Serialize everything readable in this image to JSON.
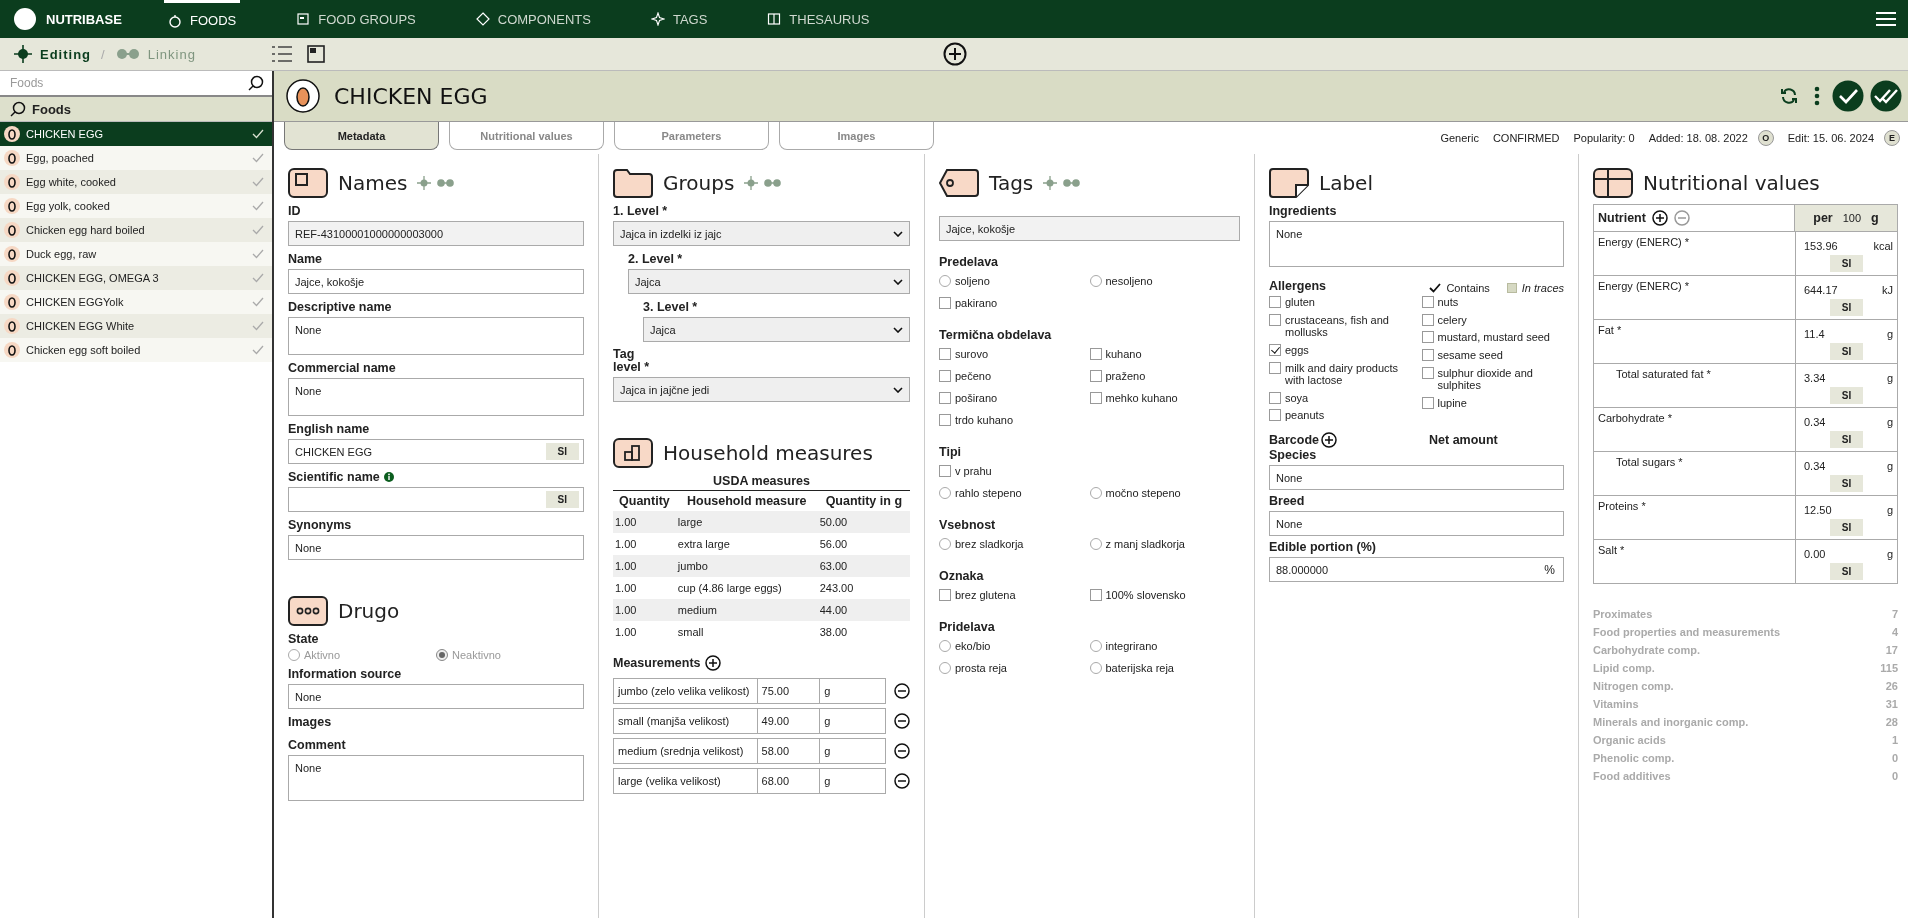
{
  "nav": {
    "brand": "NUTRIBASE",
    "items": [
      {
        "label": "FOODS",
        "kind": "timer",
        "selected": true
      },
      {
        "label": "FOOD GROUPS",
        "kind": "square",
        "selected": false
      },
      {
        "label": "COMPONENTS",
        "kind": "diamond",
        "selected": false
      },
      {
        "label": "TAGS",
        "kind": "sparkle",
        "selected": false
      },
      {
        "label": "THESAURUS",
        "kind": "book",
        "selected": false
      }
    ]
  },
  "modes": [
    {
      "label": "Editing",
      "kind": "edit",
      "selected": true
    },
    {
      "label": "Linking",
      "kind": "link",
      "selected": false
    }
  ],
  "mode_separator": "/",
  "sidebar": {
    "search_placeholder": "Foods",
    "header": "Foods",
    "items": [
      {
        "label": "CHICKEN EGG",
        "selected": true
      },
      {
        "label": "Egg, poached",
        "selected": false
      },
      {
        "label": "Egg white, cooked",
        "selected": false
      },
      {
        "label": "Egg yolk, cooked",
        "selected": false
      },
      {
        "label": "Chicken egg hard boiled",
        "selected": false
      },
      {
        "label": "Duck egg, raw",
        "selected": false
      },
      {
        "label": "CHICKEN EGG, OMEGA 3",
        "selected": false
      },
      {
        "label": "CHICKEN EGGYolk",
        "selected": false
      },
      {
        "label": "CHICKEN EGG White",
        "selected": false
      },
      {
        "label": "Chicken egg soft boiled",
        "selected": false
      }
    ]
  },
  "food": {
    "title": "CHICKEN EGG"
  },
  "tabs": [
    {
      "label": "Metadata",
      "selected": true
    },
    {
      "label": "Nutritional values",
      "selected": false
    },
    {
      "label": "Parameters",
      "selected": false
    },
    {
      "label": "Images",
      "selected": false
    }
  ],
  "status": [
    {
      "text": "Generic"
    },
    {
      "text": "CONFIRMED"
    },
    {
      "text": "Popularity: 0"
    },
    {
      "text": "Added: 18. 08. 2022",
      "badge": "O"
    },
    {
      "text": "Edit: 15. 06. 2024",
      "badge": "E"
    }
  ],
  "names": {
    "title": "Names",
    "fields": [
      {
        "label": "ID",
        "value": "REF-43100001000000003000",
        "kind": "readonly"
      },
      {
        "label": "Name",
        "value": "Jajce, kokošje",
        "kind": "text"
      },
      {
        "label": "Descriptive name",
        "value": "None",
        "kind": "textarea"
      },
      {
        "label": "Commercial name",
        "value": "None",
        "kind": "textarea"
      },
      {
        "label": "English name",
        "value": "CHICKEN EGG",
        "kind": "text",
        "si": "SI"
      },
      {
        "label": "Scientific name",
        "kind": "text",
        "si": "SI",
        "info": true
      },
      {
        "label": "Synonyms",
        "value": "None",
        "kind": "text"
      }
    ]
  },
  "drugo": {
    "title": "Drugo",
    "state": {
      "label": "State",
      "disabled": true,
      "options": [
        {
          "label": "Aktivno",
          "selected": false
        },
        {
          "label": "Neaktivno",
          "selected": true
        }
      ]
    },
    "fields": [
      {
        "label": "Information source",
        "value": "None",
        "kind": "text"
      },
      {
        "label": "Images",
        "kind": "label"
      },
      {
        "label": "Comment",
        "value": "None",
        "kind": "textarea"
      }
    ]
  },
  "groups": {
    "title": "Groups",
    "levels": [
      {
        "label": "1. Level *",
        "value": "Jajca in izdelki iz jajc"
      },
      {
        "label": "2. Level *",
        "value": "Jajca"
      },
      {
        "label": "3. Level *",
        "value": "Jajca"
      }
    ],
    "tag_level": {
      "label": "Tag level *",
      "value": "Jajca in jajčne jedi"
    }
  },
  "household": {
    "title": "Household measures",
    "usda": {
      "title": "USDA measures",
      "columns": [
        "Quantity",
        "Household measure",
        "Quantity in g"
      ],
      "rows": [
        [
          "1.00",
          "large",
          "50.00"
        ],
        [
          "1.00",
          "extra large",
          "56.00"
        ],
        [
          "1.00",
          "jumbo",
          "63.00"
        ],
        [
          "1.00",
          "cup (4.86 large eggs)",
          "243.00"
        ],
        [
          "1.00",
          "medium",
          "44.00"
        ],
        [
          "1.00",
          "small",
          "38.00"
        ]
      ]
    },
    "measurements": {
      "label": "Measurements",
      "rows": [
        {
          "name": "jumbo (zelo velika velikost)",
          "amount": "75.00",
          "unit": "g"
        },
        {
          "name": "small (manjša velikost)",
          "amount": "49.00",
          "unit": "g"
        },
        {
          "name": "medium (srednja velikost)",
          "amount": "58.00",
          "unit": "g"
        },
        {
          "name": "large (velika velikost)",
          "amount": "68.00",
          "unit": "g"
        }
      ]
    }
  },
  "tags": {
    "title": "Tags",
    "value": "Jajce, kokošje",
    "groups": [
      {
        "title": "Predelava",
        "rows": [
          [
            {
              "label": "soljeno",
              "kind": "radio",
              "selected": false
            },
            {
              "label": "nesoljeno",
              "kind": "radio",
              "selected": false
            }
          ],
          [
            {
              "label": "pakirano",
              "kind": "checkbox",
              "checked": false
            }
          ]
        ]
      },
      {
        "title": "Termična obdelava",
        "rows": [
          [
            {
              "label": "surovo",
              "kind": "checkbox",
              "checked": false
            },
            {
              "label": "kuhano",
              "kind": "checkbox",
              "checked": false
            }
          ],
          [
            {
              "label": "pečeno",
              "kind": "checkbox",
              "checked": false
            },
            {
              "label": "praženo",
              "kind": "checkbox",
              "checked": false
            }
          ],
          [
            {
              "label": "poširano",
              "kind": "checkbox",
              "checked": false
            },
            {
              "label": "mehko kuhano",
              "kind": "checkbox",
              "checked": false
            }
          ],
          [
            {
              "label": "trdo kuhano",
              "kind": "checkbox",
              "checked": false
            }
          ]
        ]
      },
      {
        "title": "Tipi",
        "rows": [
          [
            {
              "label": "v prahu",
              "kind": "checkbox",
              "checked": false
            }
          ],
          [
            {
              "label": "rahlo stepeno",
              "kind": "radio",
              "selected": false
            },
            {
              "label": "močno stepeno",
              "kind": "radio",
              "selected": false
            }
          ]
        ]
      },
      {
        "title": "Vsebnost",
        "rows": [
          [
            {
              "label": "brez sladkorja",
              "kind": "radio",
              "selected": false
            },
            {
              "label": "z manj sladkorja",
              "kind": "radio",
              "selected": false
            }
          ]
        ]
      },
      {
        "title": "Oznaka",
        "rows": [
          [
            {
              "label": "brez glutena",
              "kind": "checkbox",
              "checked": false
            },
            {
              "label": "100% slovensko",
              "kind": "checkbox",
              "checked": false
            }
          ]
        ]
      },
      {
        "title": "Pridelava",
        "rows": [
          [
            {
              "label": "eko/bio",
              "kind": "radio",
              "selected": false
            },
            {
              "label": "integrirano",
              "kind": "radio",
              "selected": false
            }
          ],
          [
            {
              "label": "prosta reja",
              "kind": "radio",
              "selected": false
            },
            {
              "label": "baterijska reja",
              "kind": "radio",
              "selected": false
            }
          ]
        ]
      }
    ]
  },
  "label": {
    "title": "Label",
    "ingredients": {
      "label": "Ingredients",
      "value": "None"
    },
    "allergens": {
      "title": "Allergens",
      "contains": "Contains",
      "in_traces": "In traces",
      "left": [
        {
          "label": "gluten",
          "checked": false
        },
        {
          "label": "crustaceans, fish and mollusks",
          "checked": false
        },
        {
          "label": "eggs",
          "checked": true
        },
        {
          "label": "milk and dairy products with lactose",
          "checked": false
        },
        {
          "label": "soya",
          "checked": false
        },
        {
          "label": "peanuts",
          "checked": false
        }
      ],
      "right": [
        {
          "label": "nuts",
          "checked": false
        },
        {
          "label": "celery",
          "checked": false
        },
        {
          "label": "mustard, mustard seed",
          "checked": false
        },
        {
          "label": "sesame seed",
          "checked": false
        },
        {
          "label": "sulphur dioxide and sulphites",
          "checked": false
        },
        {
          "label": "lupine",
          "checked": false
        }
      ]
    },
    "barcode": "Barcode",
    "net_amount": "Net amount",
    "fields": [
      {
        "label": "Species",
        "value": "None"
      },
      {
        "label": "Breed",
        "value": "None"
      }
    ],
    "edible": {
      "label": "Edible portion (%)",
      "value": "88.000000",
      "unit": "%"
    }
  },
  "nutrition": {
    "title": "Nutritional values",
    "nutrient": "Nutrient",
    "per": "per",
    "amount": "100",
    "unit": "g",
    "rows": [
      {
        "name": "Energy (ENERC) *",
        "value": "153.96",
        "unit": "kcal",
        "si": "SI"
      },
      {
        "name": "Energy (ENERC) *",
        "value": "644.17",
        "unit": "kJ",
        "si": "SI"
      },
      {
        "name": "Fat *",
        "value": "11.4",
        "unit": "g",
        "si": "SI",
        "children": [
          {
            "name": "Total saturated fat *",
            "value": "3.34",
            "unit": "g",
            "si": "SI"
          }
        ]
      },
      {
        "name": "Carbohydrate *",
        "value": "0.34",
        "unit": "g",
        "si": "SI",
        "children": [
          {
            "name": "Total sugars *",
            "value": "0.34",
            "unit": "g",
            "si": "SI"
          }
        ]
      },
      {
        "name": "Proteins *",
        "value": "12.50",
        "unit": "g",
        "si": "SI"
      },
      {
        "name": "Salt *",
        "value": "0.00",
        "unit": "g",
        "si": "SI"
      }
    ],
    "categories": [
      {
        "name": "Proximates",
        "count": "7"
      },
      {
        "name": "Food properties and measurements",
        "count": "4"
      },
      {
        "name": "Carbohydrate comp.",
        "count": "17"
      },
      {
        "name": "Lipid comp.",
        "count": "115"
      },
      {
        "name": "Nitrogen comp.",
        "count": "26"
      },
      {
        "name": "Vitamins",
        "count": "31"
      },
      {
        "name": "Minerals and inorganic comp.",
        "count": "28"
      },
      {
        "name": "Organic acids",
        "count": "1"
      },
      {
        "name": "Phenolic comp.",
        "count": "0"
      },
      {
        "name": "Food additives",
        "count": "0"
      }
    ]
  }
}
